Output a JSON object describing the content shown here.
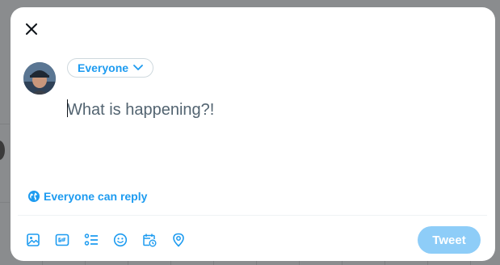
{
  "compose": {
    "audience_label": "Everyone",
    "placeholder": "What is happening?!",
    "reply_setting_label": "Everyone can reply",
    "submit_label": "Tweet"
  },
  "toolbar": {
    "icons": [
      "media-icon",
      "gif-icon",
      "poll-icon",
      "emoji-icon",
      "schedule-icon",
      "location-icon"
    ]
  },
  "colors": {
    "accent": "#1d9bf0",
    "submit_disabled": "#8ecdf8",
    "overlay": "#8a8c8e"
  }
}
